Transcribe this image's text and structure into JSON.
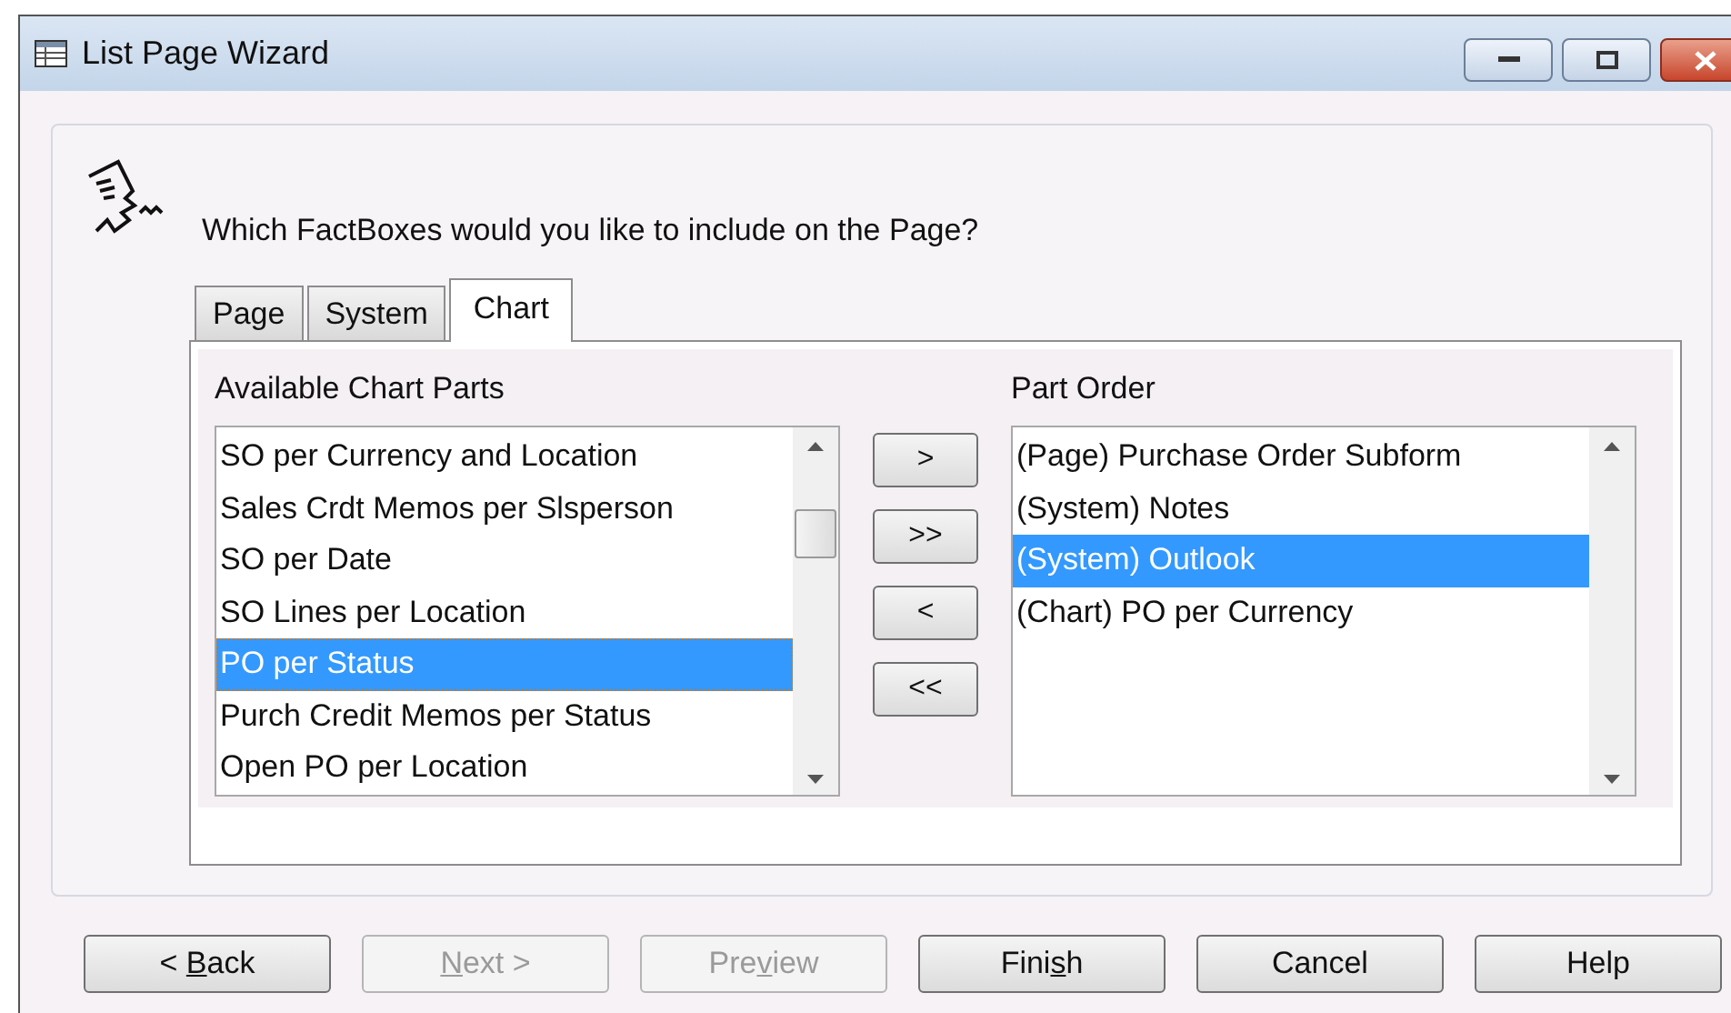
{
  "window": {
    "title": "List Page Wizard"
  },
  "question": "Which FactBoxes would you like to include on the Page?",
  "tabs": [
    {
      "label": "Page",
      "selected": false
    },
    {
      "label": "System",
      "selected": false
    },
    {
      "label": "Chart",
      "selected": true
    }
  ],
  "available": {
    "label": "Available Chart Parts",
    "focused": true,
    "items": [
      {
        "text": "SO per Currency and Location",
        "selected": false
      },
      {
        "text": "Sales Crdt Memos per Slsperson",
        "selected": false
      },
      {
        "text": "SO per Date",
        "selected": false
      },
      {
        "text": "SO Lines per Location",
        "selected": false
      },
      {
        "text": "PO per Status",
        "selected": true
      },
      {
        "text": "Purch Credit Memos per Status",
        "selected": false
      },
      {
        "text": "Open PO per Location",
        "selected": false
      }
    ]
  },
  "transfer_buttons": [
    {
      "label": ">"
    },
    {
      "label": ">>"
    },
    {
      "label": "<"
    },
    {
      "label": "<<"
    }
  ],
  "part_order": {
    "label": "Part Order",
    "focused": false,
    "items": [
      {
        "text": "(Page) Purchase Order Subform",
        "selected": false
      },
      {
        "text": "(System) Notes",
        "selected": false
      },
      {
        "text": "(System) Outlook",
        "selected": true
      },
      {
        "text": "(Chart) PO per Currency",
        "selected": false
      }
    ]
  },
  "buttons": [
    {
      "before": "< ",
      "access_key": "B",
      "after": "ack",
      "disabled": false
    },
    {
      "access_key": "N",
      "after": "ext >",
      "disabled": true
    },
    {
      "before": "Pre",
      "access_key": "v",
      "after": "iew",
      "disabled": true
    },
    {
      "before": "Fini",
      "access_key": "s",
      "after": "h",
      "disabled": false
    },
    {
      "label": "Cancel",
      "disabled": false
    },
    {
      "label": "Help",
      "disabled": false
    }
  ]
}
